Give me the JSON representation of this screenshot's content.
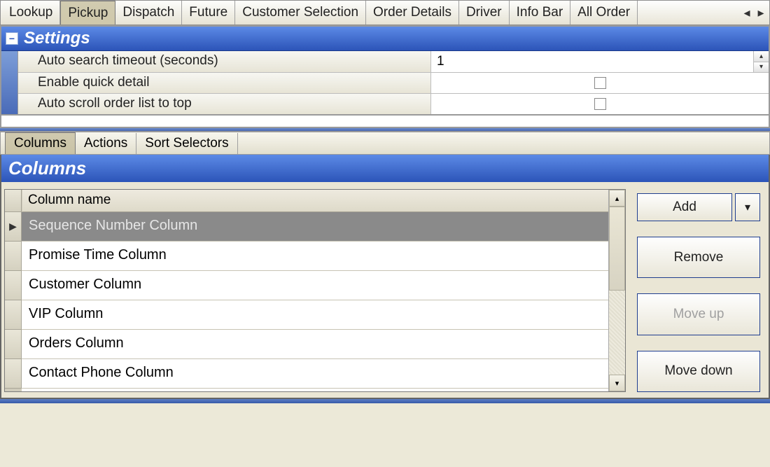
{
  "main_tabs": {
    "items": [
      "Lookup",
      "Pickup",
      "Dispatch",
      "Future",
      "Customer Selection",
      "Order Details",
      "Driver",
      "Info Bar",
      "All Order"
    ],
    "active_index": 1
  },
  "settings": {
    "title": "Settings",
    "rows": {
      "timeout_label": "Auto search timeout (seconds)",
      "timeout_value": "1",
      "quick_detail_label": "Enable quick detail",
      "quick_detail_checked": false,
      "auto_scroll_label": "Auto scroll order list to top",
      "auto_scroll_checked": false
    }
  },
  "sub_tabs": {
    "items": [
      "Columns",
      "Actions",
      "Sort Selectors"
    ],
    "active_index": 0
  },
  "columns_panel": {
    "title": "Columns",
    "grid_header": "Column name",
    "rows": [
      "Sequence Number Column",
      "Promise Time Column",
      "Customer Column",
      "VIP Column",
      "Orders Column",
      "Contact Phone Column"
    ],
    "selected_index": 0,
    "buttons": {
      "add": "Add",
      "remove": "Remove",
      "move_up": "Move up",
      "move_down": "Move down"
    }
  }
}
